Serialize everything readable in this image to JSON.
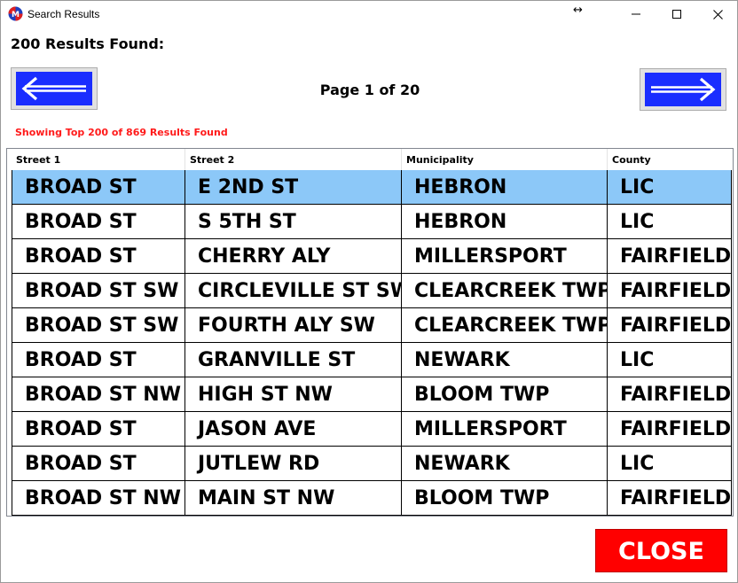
{
  "window": {
    "title": "Search Results",
    "resize_glyph": "↔"
  },
  "results_count": "200 Results Found:",
  "pager": {
    "label": "Page 1 of 20"
  },
  "showing_text": "Showing Top 200 of 869 Results Found",
  "table": {
    "columns": [
      "Street 1",
      "Street 2",
      "Municipality",
      "County"
    ],
    "rows": [
      [
        "BROAD ST",
        "E 2ND ST",
        "HEBRON",
        "LIC"
      ],
      [
        "BROAD ST",
        "S 5TH ST",
        "HEBRON",
        "LIC"
      ],
      [
        "BROAD ST",
        "CHERRY ALY",
        "MILLERSPORT",
        "FAIRFIELD"
      ],
      [
        "BROAD ST SW",
        "CIRCLEVILLE ST SW",
        "CLEARCREEK TWP",
        "FAIRFIELD"
      ],
      [
        "BROAD ST SW",
        "FOURTH ALY SW",
        "CLEARCREEK TWP",
        "FAIRFIELD"
      ],
      [
        "BROAD ST",
        "GRANVILLE ST",
        "NEWARK",
        "LIC"
      ],
      [
        "BROAD ST NW",
        "HIGH ST NW",
        "BLOOM TWP",
        "FAIRFIELD"
      ],
      [
        "BROAD ST",
        "JASON AVE",
        "MILLERSPORT",
        "FAIRFIELD"
      ],
      [
        "BROAD ST",
        "JUTLEW RD",
        "NEWARK",
        "LIC"
      ],
      [
        "BROAD ST NW",
        "MAIN ST NW",
        "BLOOM TWP",
        "FAIRFIELD"
      ]
    ],
    "selected_row": 0
  },
  "close_label": "CLOSE",
  "colors": {
    "selected_row": "#8cc8f8",
    "nav_button": "#1a2dff",
    "showing_text": "#ff1a1a",
    "close_button": "#ff0000"
  },
  "icons": {
    "app": "app-logo-icon",
    "prev": "arrow-left-icon",
    "next": "arrow-right-icon",
    "minimize": "minimize-icon",
    "maximize": "maximize-icon",
    "close": "close-icon"
  }
}
